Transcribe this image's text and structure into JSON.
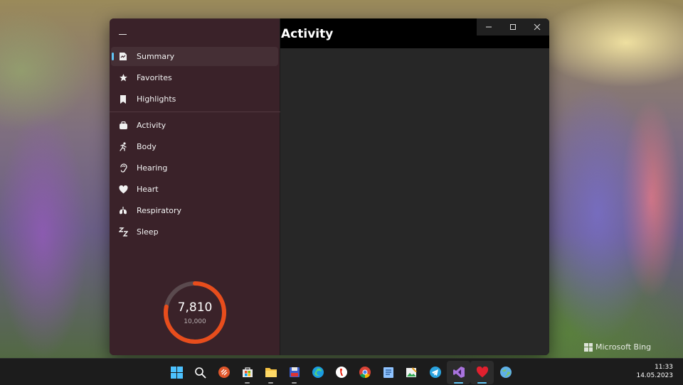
{
  "window": {
    "page_title": "Activity",
    "caption": {
      "minimize": "minimize",
      "maximize": "maximize",
      "close": "close"
    }
  },
  "nav": {
    "top_items": [
      {
        "label": "Summary",
        "icon": "summary-icon",
        "selected": true
      },
      {
        "label": "Favorites",
        "icon": "star-icon"
      },
      {
        "label": "Highlights",
        "icon": "bookmark-icon"
      }
    ],
    "category_items": [
      {
        "label": "Activity",
        "icon": "activity-icon"
      },
      {
        "label": "Body",
        "icon": "body-icon"
      },
      {
        "label": "Hearing",
        "icon": "ear-icon"
      },
      {
        "label": "Heart",
        "icon": "heart-icon"
      },
      {
        "label": "Respiratory",
        "icon": "lungs-icon"
      },
      {
        "label": "Sleep",
        "icon": "sleep-icon"
      }
    ]
  },
  "steps_ring": {
    "value": "7,810",
    "goal": "10,000",
    "progress": 0.781,
    "color": "#e84d1c",
    "track_color": "#5a4a4e"
  },
  "accent_color": "#60c4f4",
  "watermark": {
    "text": "Microsoft Bing"
  },
  "taskbar": {
    "icons": [
      "windows-start-icon",
      "search-icon",
      "remote-desktop-icon",
      "microsoft-store-icon",
      "file-explorer-icon",
      "save-disk-icon",
      "edge-browser-icon",
      "yandex-browser-icon",
      "chrome-browser-icon",
      "notepad-icon",
      "image-editor-icon",
      "telegram-icon",
      "visual-studio-icon",
      "health-app-icon",
      "weather-globe-icon"
    ],
    "time": "11:33",
    "date": "14.05.2023"
  }
}
